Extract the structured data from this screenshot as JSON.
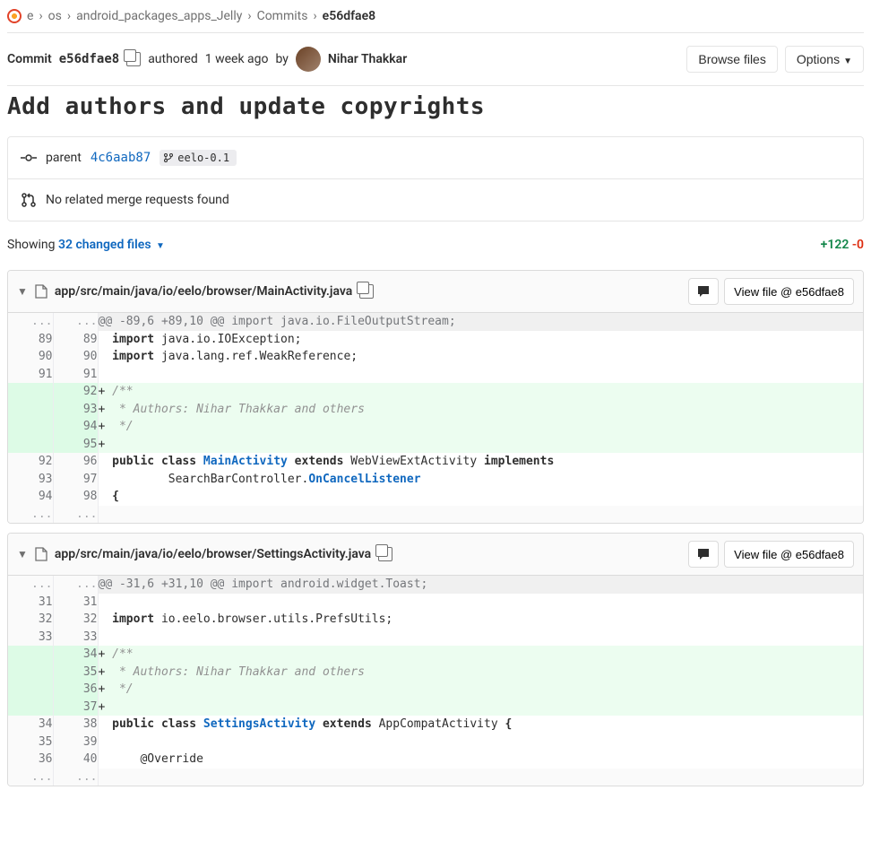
{
  "breadcrumb": {
    "root": "e",
    "group": "os",
    "project": "android_packages_apps_Jelly",
    "section": "Commits",
    "current": "e56dfae8"
  },
  "commit": {
    "label": "Commit",
    "sha": "e56dfae8",
    "authored_prefix": "authored",
    "time": "1 week ago",
    "by": "by",
    "author": "Nihar Thakkar",
    "browse_files": "Browse files",
    "options": "Options",
    "title": "Add authors and update copyrights"
  },
  "parent": {
    "label": "parent",
    "sha": "4c6aab87",
    "branch": "eelo-0.1"
  },
  "related": "No related merge requests found",
  "changes": {
    "showing": "Showing",
    "files_link": "32 changed files",
    "additions": "+122",
    "deletions": "-0"
  },
  "view_file_prefix": "View file @",
  "files": [
    {
      "path": "app/src/main/java/io/eelo/browser/MainActivity.java",
      "view_sha": "e56dfae8",
      "hunk": "@@ -89,6 +89,10 @@ import java.io.FileOutputStream;",
      "lines": [
        {
          "o": "89",
          "n": "89",
          "t": "ctx",
          "html": "<span class='tok-kw'>import</span> java.io.IOException<span class='tok-pun'>;</span>"
        },
        {
          "o": "90",
          "n": "90",
          "t": "ctx",
          "html": "<span class='tok-kw'>import</span> java.lang.ref.WeakReference<span class='tok-pun'>;</span>"
        },
        {
          "o": "91",
          "n": "91",
          "t": "ctx",
          "html": ""
        },
        {
          "o": "",
          "n": "92",
          "t": "add",
          "html": "<span class='tok-cmt'>/**</span>"
        },
        {
          "o": "",
          "n": "93",
          "t": "add",
          "html": "<span class='tok-cmt'> * Authors: Nihar Thakkar and others</span>"
        },
        {
          "o": "",
          "n": "94",
          "t": "add",
          "html": "<span class='tok-cmt'> */</span>"
        },
        {
          "o": "",
          "n": "95",
          "t": "add",
          "html": ""
        },
        {
          "o": "92",
          "n": "96",
          "t": "ctx",
          "html": "<span class='tok-kw'>public</span> <span class='tok-kw'>class</span> <span class='tok-cls'>MainActivity</span> <span class='tok-kw'>extends</span> WebViewExtActivity <span class='tok-kw'>implements</span>"
        },
        {
          "o": "93",
          "n": "97",
          "t": "ctx",
          "html": "        SearchBarController<span class='tok-pun'>.</span><span class='tok-cls'>OnCancelListener</span>"
        },
        {
          "o": "94",
          "n": "98",
          "t": "ctx",
          "html": "<span class='tok-kw'>{</span>"
        }
      ]
    },
    {
      "path": "app/src/main/java/io/eelo/browser/SettingsActivity.java",
      "view_sha": "e56dfae8",
      "hunk": "@@ -31,6 +31,10 @@ import android.widget.Toast;",
      "lines": [
        {
          "o": "31",
          "n": "31",
          "t": "ctx",
          "html": ""
        },
        {
          "o": "32",
          "n": "32",
          "t": "ctx",
          "html": "<span class='tok-kw'>import</span> io.eelo.browser.utils.PrefsUtils<span class='tok-pun'>;</span>"
        },
        {
          "o": "33",
          "n": "33",
          "t": "ctx",
          "html": ""
        },
        {
          "o": "",
          "n": "34",
          "t": "add",
          "html": "<span class='tok-cmt'>/**</span>"
        },
        {
          "o": "",
          "n": "35",
          "t": "add",
          "html": "<span class='tok-cmt'> * Authors: Nihar Thakkar and others</span>"
        },
        {
          "o": "",
          "n": "36",
          "t": "add",
          "html": "<span class='tok-cmt'> */</span>"
        },
        {
          "o": "",
          "n": "37",
          "t": "add",
          "html": ""
        },
        {
          "o": "34",
          "n": "38",
          "t": "ctx",
          "html": "<span class='tok-kw'>public</span> <span class='tok-kw'>class</span> <span class='tok-cls'>SettingsActivity</span> <span class='tok-kw'>extends</span> AppCompatActivity <span class='tok-kw'>{</span>"
        },
        {
          "o": "35",
          "n": "39",
          "t": "ctx",
          "html": ""
        },
        {
          "o": "36",
          "n": "40",
          "t": "ctx",
          "html": "    @Override"
        }
      ]
    }
  ]
}
